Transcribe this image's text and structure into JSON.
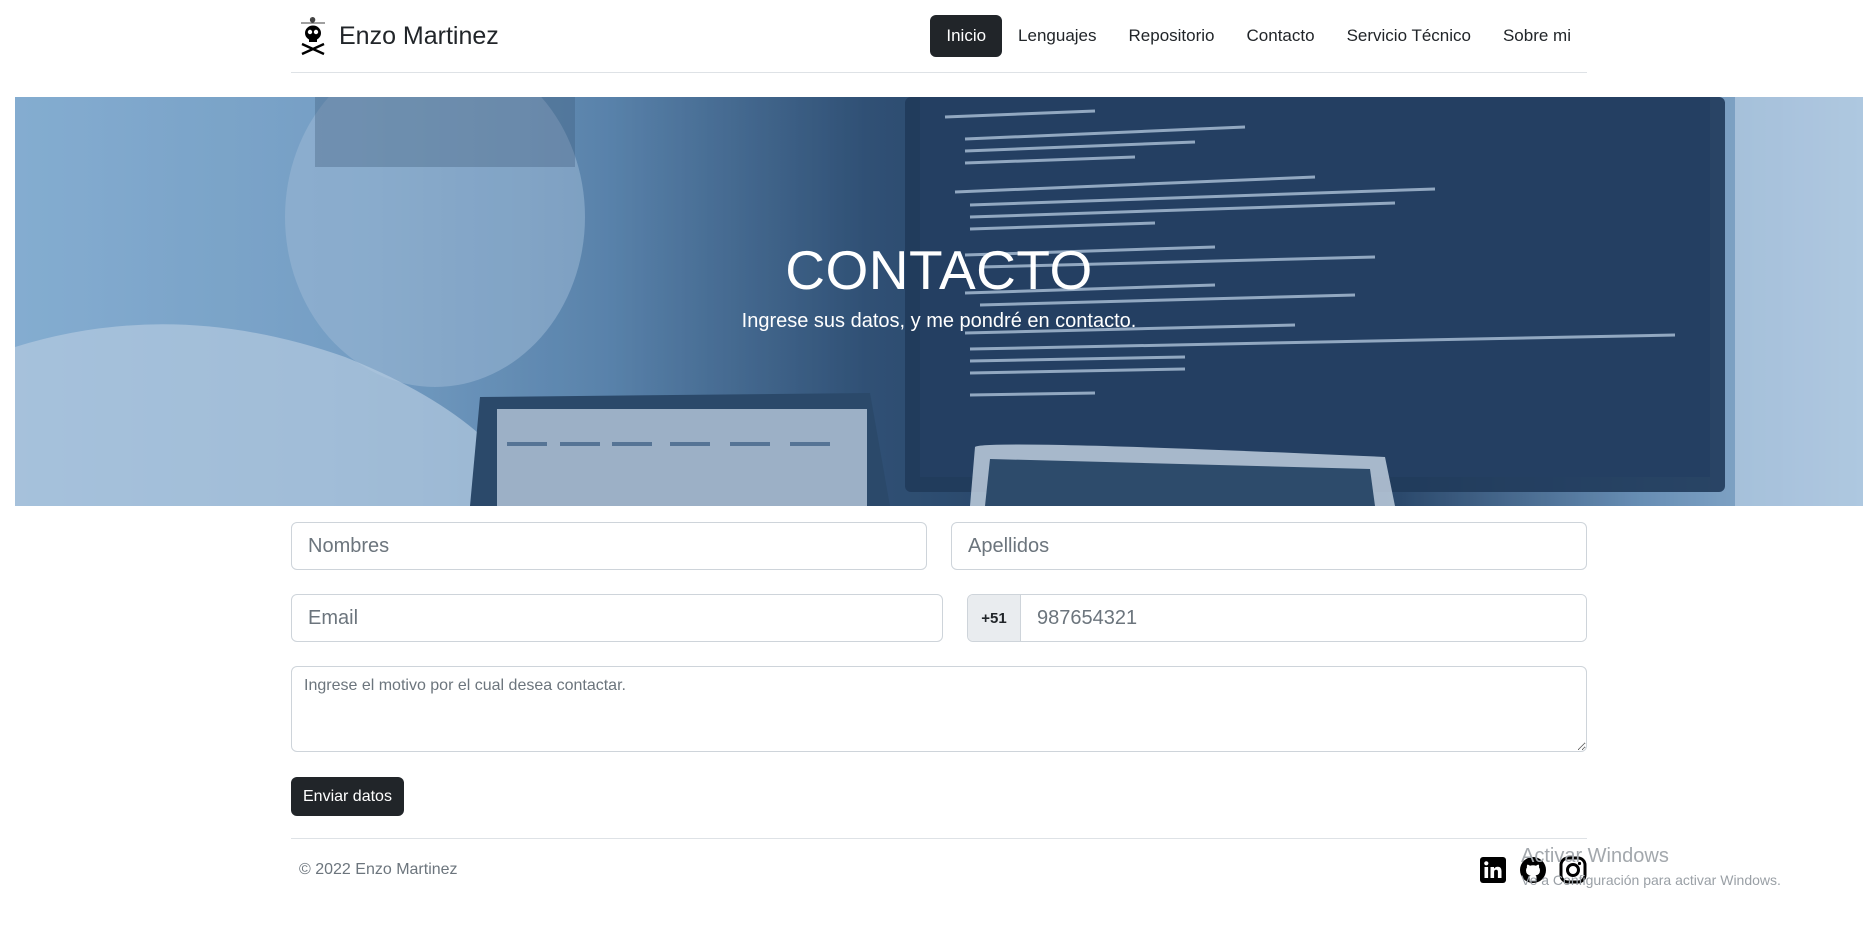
{
  "header": {
    "brand_name": "Enzo Martinez",
    "nav": [
      {
        "label": "Inicio",
        "active": true
      },
      {
        "label": "Lenguajes",
        "active": false
      },
      {
        "label": "Repositorio",
        "active": false
      },
      {
        "label": "Contacto",
        "active": false
      },
      {
        "label": "Servicio Técnico",
        "active": false
      },
      {
        "label": "Sobre mi",
        "active": false
      }
    ]
  },
  "hero": {
    "title": "CONTACTO",
    "subtitle": "Ingrese sus datos, y me pondré en contacto."
  },
  "form": {
    "first_name_placeholder": "Nombres",
    "last_name_placeholder": "Apellidos",
    "email_placeholder": "Email",
    "phone_prefix": "+51",
    "phone_placeholder": "987654321",
    "message_placeholder": "Ingrese el motivo por el cual desea contactar.",
    "submit_label": "Enviar datos"
  },
  "footer": {
    "copyright": "© 2022 Enzo Martinez",
    "social_icons": [
      "linkedin-icon",
      "github-icon",
      "instagram-icon"
    ]
  },
  "watermark": {
    "title": "Activar Windows",
    "subtitle": "Ve a Configuración para activar Windows."
  },
  "colors": {
    "dark": "#212529",
    "muted": "#6c757d",
    "border": "#ced4da"
  }
}
